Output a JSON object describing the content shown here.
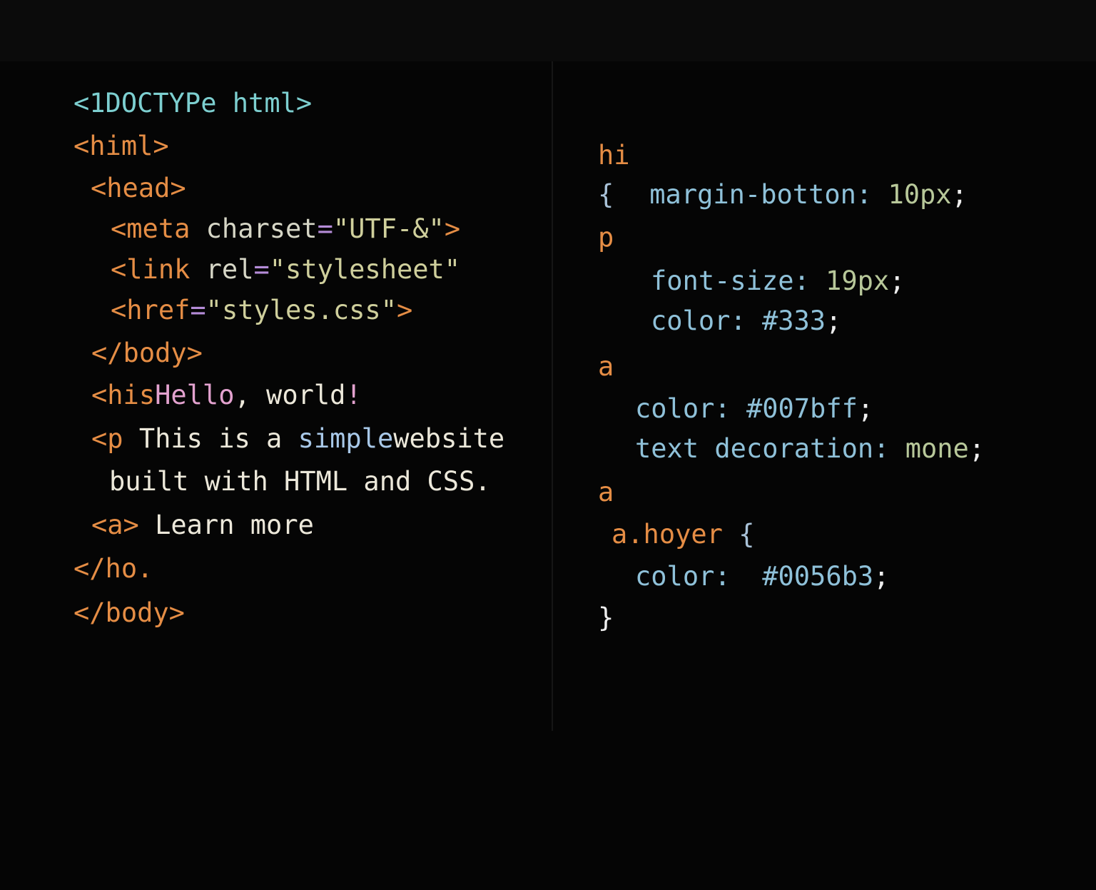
{
  "html_pane": {
    "lines": [
      {
        "t0": "<",
        "t1": "1DOCTYPe html",
        "t2": ">"
      },
      {
        "t0": "<himl>"
      },
      {
        "t0": "<head>"
      },
      {
        "t0": "<meta ",
        "t1": "charset",
        "t2": "=",
        "t3": "\"UTF-&\"",
        "t4": ">"
      },
      {
        "t0": "<link ",
        "t1": "rel",
        "t2": "=",
        "t3": "\"stylesheet\""
      },
      {
        "t0": "<href",
        "t1": "=",
        "t2": "\"styles.css\"",
        "t3": ">"
      },
      {
        "t0": "</body>"
      },
      {
        "t0": "<his",
        "t1": "Hello",
        "t2": ", world",
        "t3": "!"
      },
      {
        "t0": "<p ",
        "t1": "This is a ",
        "t2": "simple",
        "t3": "website"
      },
      {
        "t0": "built with HTML and CSS."
      },
      {
        "t0": "<a> ",
        "t1": "Learn more"
      },
      {
        "t0": "</ho."
      },
      {
        "t0": "</body>"
      }
    ]
  },
  "css_pane": {
    "lines": [
      {
        "t0": "hi"
      },
      {
        "t0": "{",
        "t1": "margin-botton",
        "t2": ": ",
        "t3": "10px",
        "t4": ";"
      },
      {
        "t0": "p"
      },
      {
        "t0": "font-size",
        "t1": ": ",
        "t2": "19px",
        "t3": ";"
      },
      {
        "t0": "color",
        "t1": ": ",
        "t2": "#333",
        "t3": ";"
      },
      {
        "t0": "a"
      },
      {
        "t0": "color",
        "t1": ": ",
        "t2": "#007bff",
        "t3": ";"
      },
      {
        "t0": "text decoration",
        "t1": ": ",
        "t2": "mone",
        "t3": ";"
      },
      {
        "t0": "a"
      },
      {
        "t0": "a.hoyer",
        "t1": " {"
      },
      {
        "t0": "color",
        "t1": ":  ",
        "t2": "#0056b3",
        "t3": ";"
      },
      {
        "t0": "}"
      }
    ]
  },
  "colors": {
    "background": "#050505",
    "topbar": "#0b0b0b",
    "tag": "#e58d45",
    "doctype": "#7dcfd0",
    "attribute": "#d6d6c6",
    "string": "#cfcf9c",
    "equals": "#b58cd8",
    "highlight_text": "#e3a2cf",
    "plain_text": "#ece8da",
    "css_property": "#8fc1d9",
    "css_value": "#b8c89a"
  }
}
